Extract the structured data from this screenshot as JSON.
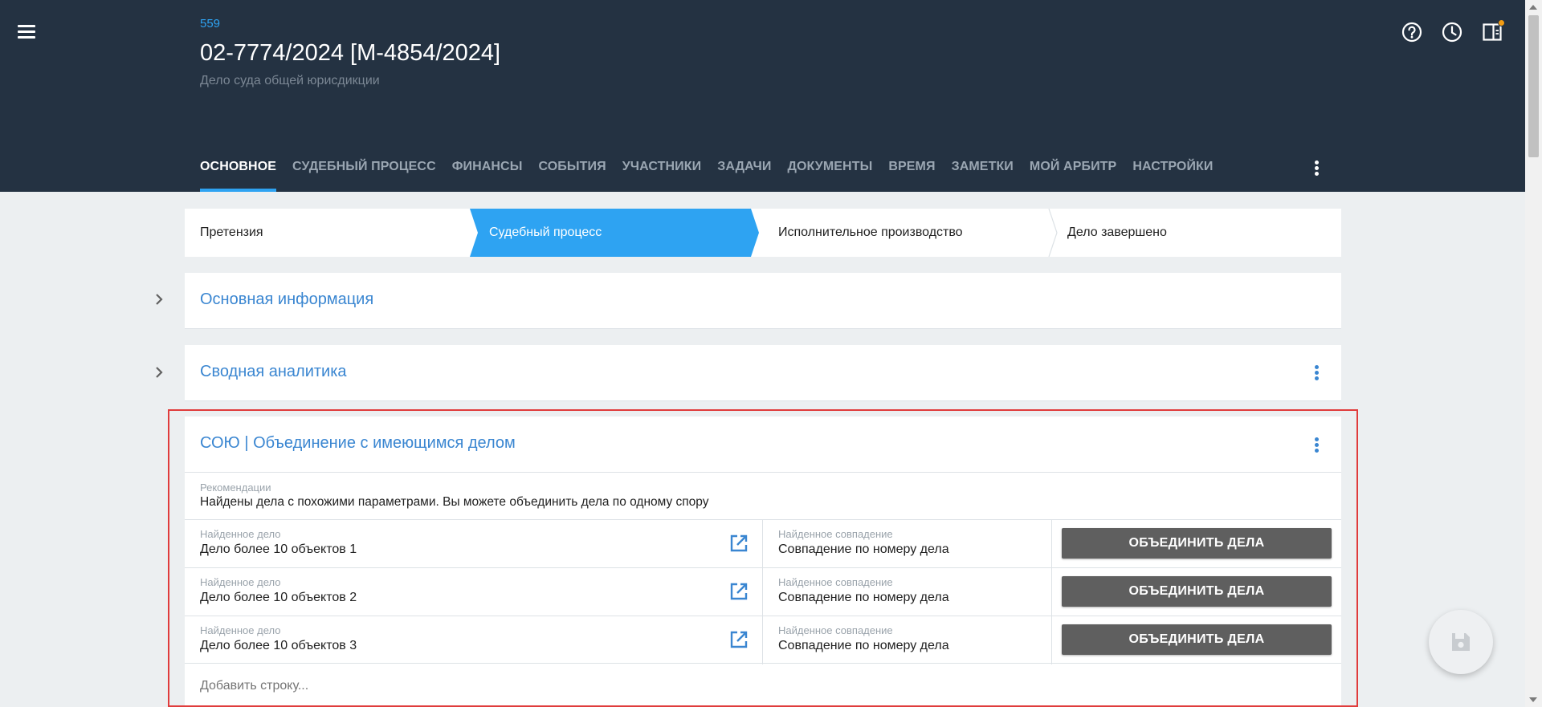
{
  "header": {
    "case_id": "559",
    "title": "02-7774/2024 [М-4854/2024]",
    "subtitle": "Дело суда общей юрисдикции",
    "icons": [
      "help-icon",
      "history-clock-icon",
      "panel-toggle-icon"
    ],
    "notification_dot_color": "#f39c12"
  },
  "tabs": [
    {
      "label": "ОСНОВНОЕ",
      "active": true
    },
    {
      "label": "СУДЕБНЫЙ ПРОЦЕСС"
    },
    {
      "label": "ФИНАНСЫ"
    },
    {
      "label": "СОБЫТИЯ"
    },
    {
      "label": "УЧАСТНИКИ"
    },
    {
      "label": "ЗАДАЧИ"
    },
    {
      "label": "ДОКУМЕНТЫ"
    },
    {
      "label": "ВРЕМЯ"
    },
    {
      "label": "ЗАМЕТКИ"
    },
    {
      "label": "МОЙ АРБИТР"
    },
    {
      "label": "НАСТРОЙКИ"
    }
  ],
  "stepper": [
    {
      "label": "Претензия",
      "active": false
    },
    {
      "label": "Судебный процесс",
      "active": true
    },
    {
      "label": "Исполнительное производство",
      "active": false
    },
    {
      "label": "Дело завершено",
      "active": false
    }
  ],
  "sections": {
    "main_info": "Основная информация",
    "analytics": "Сводная аналитика"
  },
  "merge": {
    "title": "СОЮ | Объединение с имеющимся делом",
    "recommendation_label": "Рекомендации",
    "recommendation_text": "Найдены дела с похожими параметрами. Вы можете объединить дела по одному спору",
    "rows": [
      {
        "found_label": "Найденное дело",
        "found_value": "Дело более 10 объектов 1",
        "match_label": "Найденное совпадение",
        "match_value": "Совпадение по номеру дела",
        "button": "ОБЪЕДИНИТЬ ДЕЛА"
      },
      {
        "found_label": "Найденное дело",
        "found_value": "Дело более 10 объектов 2",
        "match_label": "Найденное совпадение",
        "match_value": "Совпадение по номеру дела",
        "button": "ОБЪЕДИНИТЬ ДЕЛА"
      },
      {
        "found_label": "Найденное дело",
        "found_value": "Дело более 10 объектов 3",
        "match_label": "Найденное совпадение",
        "match_value": "Совпадение по номеру дела",
        "button": "ОБЪЕДИНИТЬ ДЕЛА"
      }
    ],
    "add_row": "Добавить строку..."
  },
  "colors": {
    "header_bg": "#243242",
    "accent": "#2ea3f2",
    "section_title": "#3a86d1",
    "highlight_border": "#e03c3c",
    "merge_button": "#5f5f5f"
  }
}
